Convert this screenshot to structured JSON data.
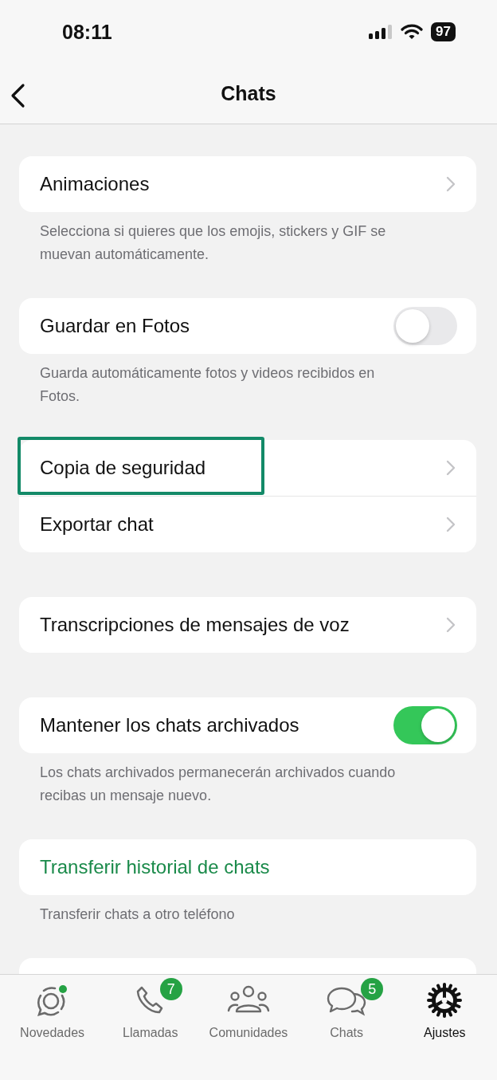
{
  "status_bar": {
    "time": "08:11",
    "battery": "97"
  },
  "nav": {
    "title": "Chats"
  },
  "sections": [
    {
      "rows": [
        {
          "label": "Animaciones",
          "kind": "link",
          "highlighted": false
        }
      ],
      "footer": "Selecciona si quieres que los emojis, stickers y GIF se muevan automáticamente."
    },
    {
      "rows": [
        {
          "label": "Guardar en Fotos",
          "kind": "toggle",
          "on": false,
          "highlighted": false
        }
      ],
      "footer": "Guarda automáticamente fotos y videos recibidos en Fotos."
    },
    {
      "rows": [
        {
          "label": "Copia de seguridad",
          "kind": "link",
          "highlighted": true
        },
        {
          "label": "Exportar chat",
          "kind": "link",
          "highlighted": false
        }
      ]
    },
    {
      "rows": [
        {
          "label": "Transcripciones de mensajes de voz",
          "kind": "link",
          "highlighted": false
        }
      ]
    },
    {
      "rows": [
        {
          "label": "Mantener los chats archivados",
          "kind": "toggle",
          "on": true,
          "highlighted": false
        }
      ],
      "footer": "Los chats archivados permanecerán archivados cuando recibas un mensaje nuevo."
    },
    {
      "rows": [
        {
          "label": "Transferir historial de chats",
          "kind": "action",
          "highlighted": false
        }
      ],
      "footer": "Transferir chats a otro teléfono"
    }
  ],
  "tabs": [
    {
      "label": "Novedades",
      "kind": "status",
      "selected": false,
      "dot": true
    },
    {
      "label": "Llamadas",
      "kind": "calls",
      "selected": false,
      "badge": "7"
    },
    {
      "label": "Comunidades",
      "kind": "communities",
      "selected": false
    },
    {
      "label": "Chats",
      "kind": "chats",
      "selected": false,
      "badge": "5"
    },
    {
      "label": "Ajustes",
      "kind": "settings",
      "selected": true
    }
  ]
}
